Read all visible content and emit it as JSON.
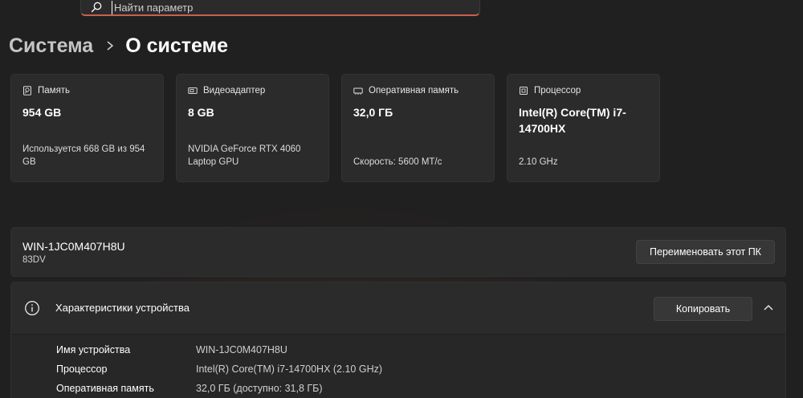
{
  "search": {
    "placeholder": "Найти параметр",
    "value": ""
  },
  "breadcrumb": {
    "parent": "Система",
    "current": "О системе"
  },
  "cards": [
    {
      "icon": "storage-icon",
      "label": "Память",
      "value": "954 GB",
      "sub": "Используется 668 GB из 954 GB"
    },
    {
      "icon": "gpu-icon",
      "label": "Видеоадаптер",
      "value": "8 GB",
      "sub": "NVIDIA GeForce RTX 4060 Laptop GPU"
    },
    {
      "icon": "ram-icon",
      "label": "Оперативная память",
      "value": "32,0 ГБ",
      "sub": "Скорость: 5600 МТ/с"
    },
    {
      "icon": "processor-icon",
      "label": "Процессор",
      "value": "Intel(R) Core(TM) i7-14700HX",
      "sub": "2.10 GHz"
    }
  ],
  "pc": {
    "name": "WIN-1JC0M407H8U",
    "model": "83DV",
    "rename_label": "Переименовать этот ПК"
  },
  "specs": {
    "title": "Характеристики устройства",
    "copy_label": "Копировать",
    "rows": [
      {
        "key": "Имя устройства",
        "value": "WIN-1JC0M407H8U"
      },
      {
        "key": "Процессор",
        "value": "Intel(R) Core(TM) i7-14700HX (2.10 GHz)"
      },
      {
        "key": "Оперативная память",
        "value": "32,0 ГБ (доступно: 31,8 ГБ)"
      }
    ]
  }
}
